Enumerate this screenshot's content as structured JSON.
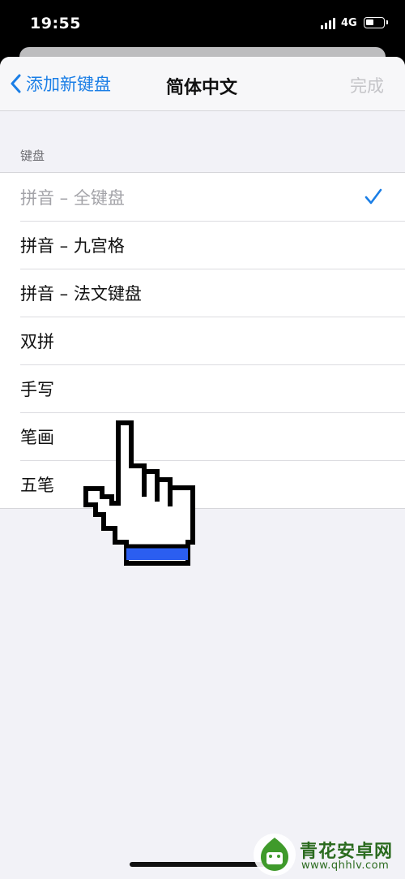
{
  "status_bar": {
    "time": "19:55",
    "network": "4G"
  },
  "nav": {
    "back_label": "添加新键盘",
    "title": "简体中文",
    "done_label": "完成"
  },
  "keyboard_section": {
    "header": "键盘",
    "items": [
      {
        "label": "拼音 – 全键盘",
        "checked": true,
        "disabled": true
      },
      {
        "label": "拼音 – 九宫格",
        "checked": false,
        "disabled": false
      },
      {
        "label": "拼音 – 法文键盘",
        "checked": false,
        "disabled": false
      },
      {
        "label": "双拼",
        "checked": false,
        "disabled": false
      },
      {
        "label": "手写",
        "checked": false,
        "disabled": false
      },
      {
        "label": "笔画",
        "checked": false,
        "disabled": false
      },
      {
        "label": "五笔",
        "checked": false,
        "disabled": false
      }
    ]
  },
  "watermark": {
    "title": "青花安卓网",
    "url": "www.qhhlv.com"
  },
  "colors": {
    "accent": "#1a7ee6",
    "disabled_text": "#a3a3a8",
    "background": "#f2f2f7",
    "pointer_cuff": "#2b5ef0"
  }
}
